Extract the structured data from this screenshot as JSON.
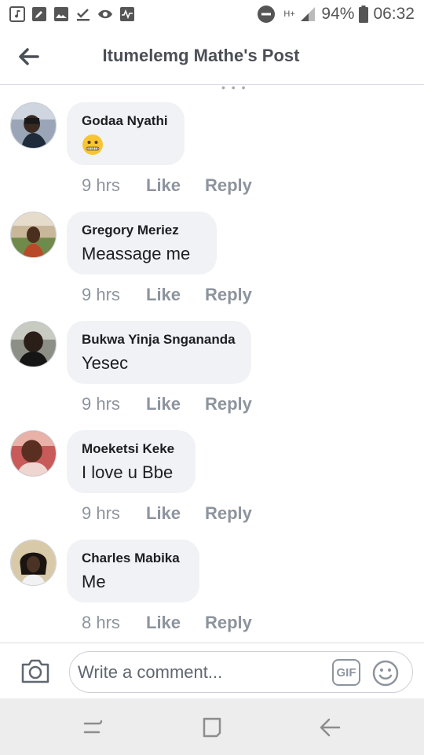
{
  "status_bar": {
    "battery": "94%",
    "time": "06:32",
    "network": "H+"
  },
  "header": {
    "title": "Itumelemg Mathe's Post"
  },
  "comments": [
    {
      "author": "Godaa Nyathi",
      "text": "",
      "emoji": "zipper-mouth-face",
      "time": "9 hrs",
      "like": "Like",
      "reply": "Reply"
    },
    {
      "author": "Gregory Meriez",
      "text": "Meassage me",
      "time": "9 hrs",
      "like": "Like",
      "reply": "Reply"
    },
    {
      "author": "Bukwa Yinja Sngananda",
      "text": "Yesec",
      "time": "9 hrs",
      "like": "Like",
      "reply": "Reply"
    },
    {
      "author": "Moeketsi Keke",
      "text": "I love u Bbe",
      "time": "9 hrs",
      "like": "Like",
      "reply": "Reply"
    },
    {
      "author": "Charles Mabika",
      "text": "Me",
      "time": "8 hrs",
      "like": "Like",
      "reply": "Reply"
    }
  ],
  "composer": {
    "placeholder": "Write a comment...",
    "gif_label": "GIF"
  },
  "colors": {
    "bubble": "#f0f2f5",
    "meta_text": "#8d949e",
    "header_title": "#4b4f56"
  }
}
